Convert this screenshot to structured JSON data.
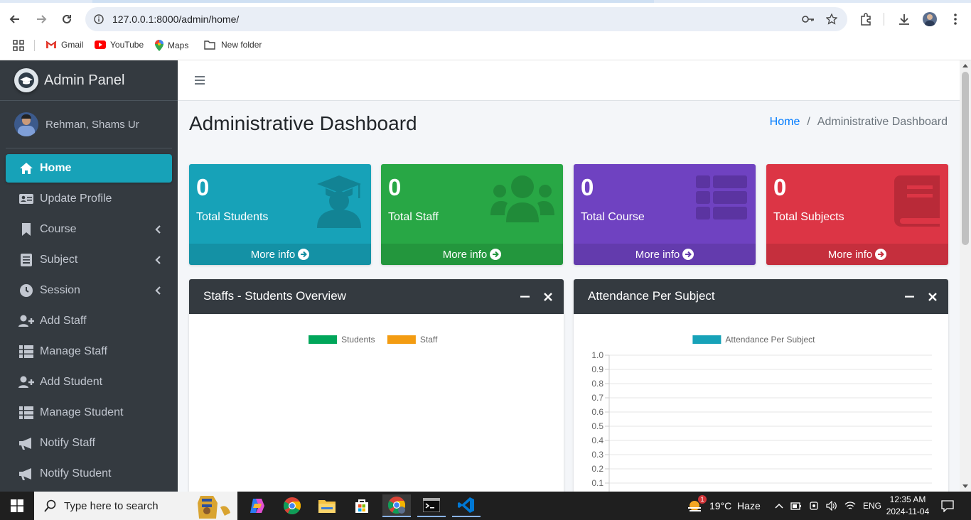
{
  "browser": {
    "url": "127.0.0.1:8000/admin/home/",
    "bookmarks": [
      "Gmail",
      "YouTube",
      "Maps",
      "New folder"
    ]
  },
  "sidebar": {
    "brand": "Admin Panel",
    "user": "Rehman, Shams Ur",
    "items": [
      {
        "label": "Home",
        "icon": "home-icon",
        "active": true
      },
      {
        "label": "Update Profile",
        "icon": "id-card-icon"
      },
      {
        "label": "Course",
        "icon": "bookmark-icon",
        "arrow": true
      },
      {
        "label": "Subject",
        "icon": "book-icon",
        "arrow": true
      },
      {
        "label": "Session",
        "icon": "clock-icon",
        "arrow": true
      },
      {
        "label": "Add Staff",
        "icon": "user-plus-icon"
      },
      {
        "label": "Manage Staff",
        "icon": "grid-icon"
      },
      {
        "label": "Add Student",
        "icon": "user-plus-icon"
      },
      {
        "label": "Manage Student",
        "icon": "grid-icon"
      },
      {
        "label": "Notify Staff",
        "icon": "megaphone-icon"
      },
      {
        "label": "Notify Student",
        "icon": "megaphone-icon"
      }
    ]
  },
  "main": {
    "title": "Administrative Dashboard",
    "breadcrumb": {
      "home": "Home",
      "sep": "/",
      "current": "Administrative Dashboard"
    },
    "boxes": [
      {
        "value": "0",
        "label": "Total Students",
        "footer": "More info",
        "color": "#17a2b8",
        "icon": "graduate-icon"
      },
      {
        "value": "0",
        "label": "Total Staff",
        "footer": "More info",
        "color": "#28a745",
        "icon": "users-icon"
      },
      {
        "value": "0",
        "label": "Total Course",
        "footer": "More info",
        "color": "#6f42c1",
        "icon": "list-icon"
      },
      {
        "value": "0",
        "label": "Total Subjects",
        "footer": "More info",
        "color": "#dc3545",
        "icon": "book-icon"
      }
    ],
    "cards": [
      {
        "title": "Staffs - Students Overview"
      },
      {
        "title": "Attendance Per Subject"
      }
    ]
  },
  "chart_data": [
    {
      "type": "bar",
      "title": "",
      "series": [
        {
          "name": "Students",
          "color": "#00a65a",
          "values": []
        },
        {
          "name": "Staff",
          "color": "#f39c12",
          "values": []
        }
      ],
      "categories": []
    },
    {
      "type": "bar",
      "title": "",
      "series": [
        {
          "name": "Attendance Per Subject",
          "color": "#17a2b8",
          "values": []
        }
      ],
      "categories": [],
      "ylim": [
        0,
        1.0
      ],
      "yticks": [
        "1.0",
        "0.9",
        "0.8",
        "0.7",
        "0.6",
        "0.5",
        "0.4",
        "0.3",
        "0.2",
        "0.1"
      ],
      "grid": true,
      "legend": "top"
    }
  ],
  "taskbar": {
    "search_placeholder": "Type here to search",
    "weather": "19°C  Haze",
    "weather_badge": "1",
    "lang": "ENG",
    "time": "12:35 AM",
    "date": "2024-11-04"
  }
}
